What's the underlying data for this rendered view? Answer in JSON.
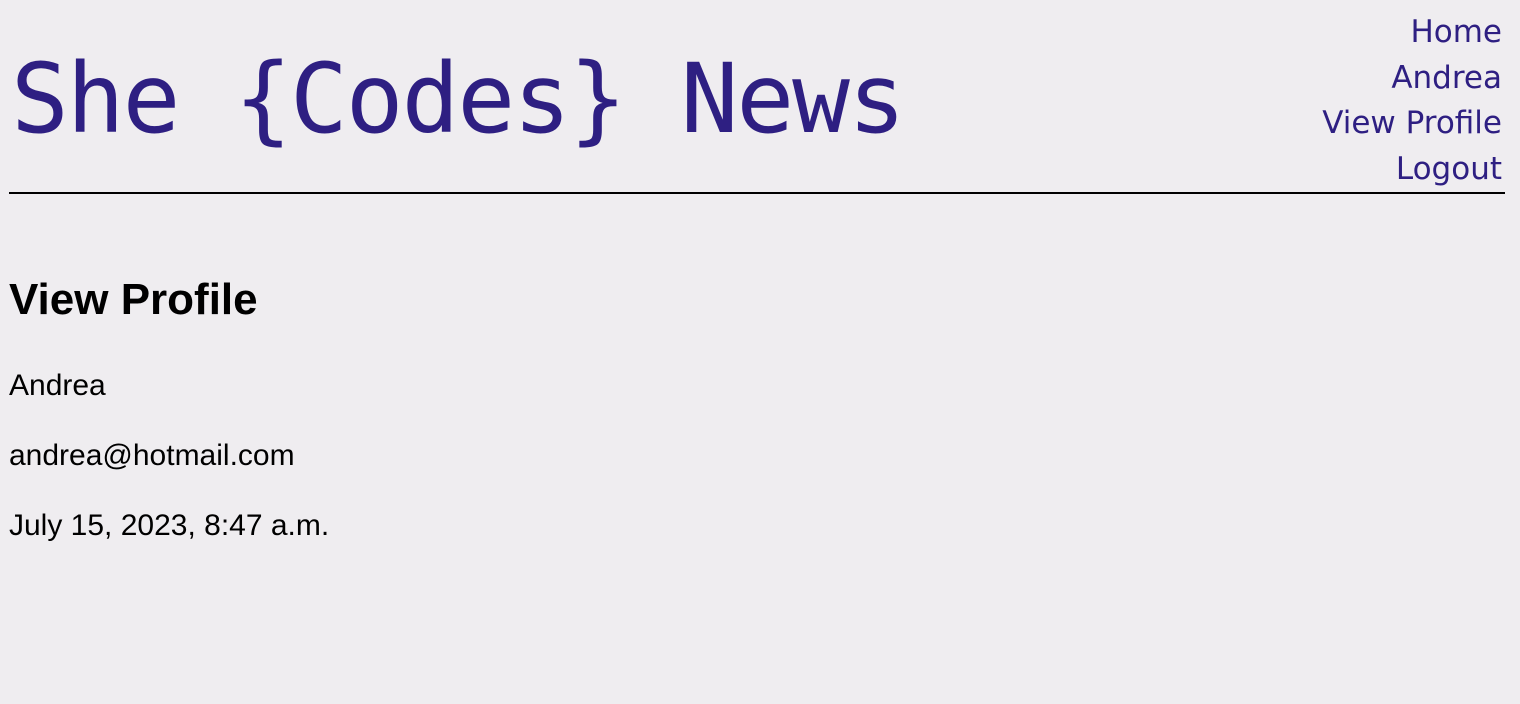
{
  "header": {
    "title": "She {Codes} News",
    "nav": [
      "Home",
      "Andrea",
      "View Profile",
      "Logout"
    ]
  },
  "main": {
    "heading": "View Profile",
    "username": "Andrea",
    "email": "andrea@hotmail.com",
    "date_joined": "July 15, 2023, 8:47 a.m."
  }
}
